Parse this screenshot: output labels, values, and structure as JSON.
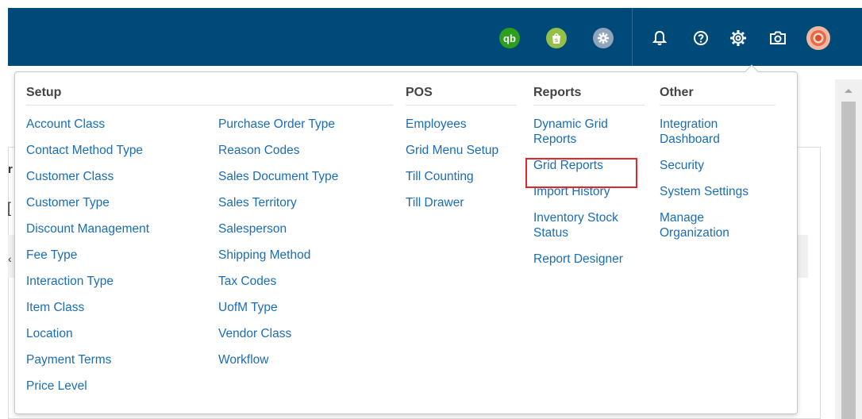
{
  "header": {
    "icons": [
      "quickbooks-icon",
      "shopify-icon",
      "settings-circle-icon",
      "bell-icon",
      "help-icon",
      "gear-icon",
      "camera-icon",
      "avatar"
    ],
    "qb_label": "qb"
  },
  "colors": {
    "header_bg": "#004a79",
    "link": "#1a6db5",
    "highlight": "#e0272c"
  },
  "background_text": {
    "char1": "r",
    "char2": "[",
    "char3": "‹"
  },
  "menu": {
    "setup": {
      "title": "Setup",
      "col1": [
        "Account Class",
        "Contact Method Type",
        "Customer Class",
        "Customer Type",
        "Discount Management",
        "Fee Type",
        "Interaction Type",
        "Item Class",
        "Location",
        "Payment Terms",
        "Price Level"
      ],
      "col2": [
        "Purchase Order Type",
        "Reason Codes",
        "Sales Document Type",
        "Sales Territory",
        "Salesperson",
        "Shipping Method",
        "Tax Codes",
        "UofM Type",
        "Vendor Class",
        "Workflow"
      ]
    },
    "pos": {
      "title": "POS",
      "items": [
        "Employees",
        "Grid Menu Setup",
        "Till Counting",
        "Till Drawer"
      ]
    },
    "reports": {
      "title": "Reports",
      "items": [
        "Dynamic Grid Reports",
        "Grid Reports",
        "Import History",
        "Inventory Stock Status",
        "Report Designer"
      ],
      "highlighted": "Grid Reports"
    },
    "other": {
      "title": "Other",
      "items": [
        "Integration Dashboard",
        "Security",
        "System Settings",
        "Manage Organization"
      ]
    }
  }
}
